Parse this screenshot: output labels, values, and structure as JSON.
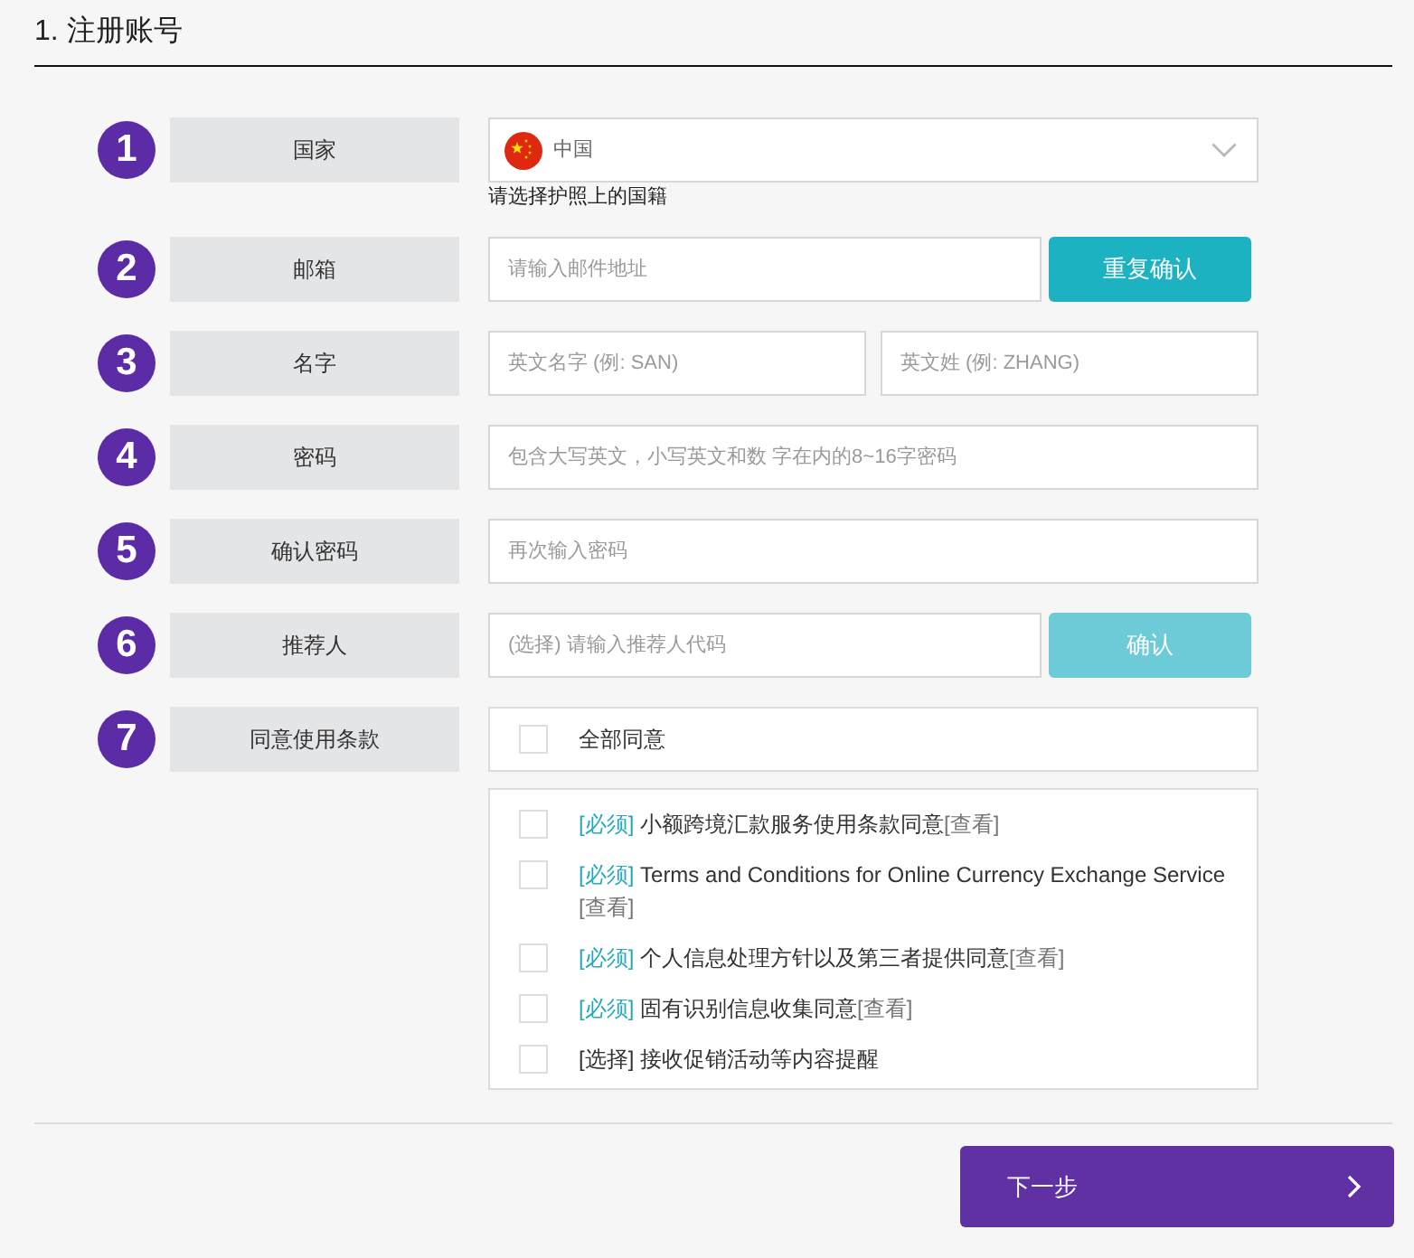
{
  "section_title": "1. 注册账号",
  "rows": [
    {
      "number": "1",
      "label": "国家",
      "kind": "select",
      "value": "中国",
      "hint": "请选择护照上的国籍"
    },
    {
      "number": "2",
      "label": "邮箱",
      "kind": "input_button",
      "placeholder": "请输入邮件地址",
      "button": {
        "label": "重复确认",
        "disabled": false
      }
    },
    {
      "number": "3",
      "label": "名字",
      "kind": "input_pair",
      "fields": [
        {
          "placeholder": "英文名字 (例: SAN)"
        },
        {
          "placeholder": "英文姓 (例: ZHANG)"
        }
      ]
    },
    {
      "number": "4",
      "label": "密码",
      "kind": "input",
      "placeholder": "包含大写英文，小写英文和数 字在内的8~16字密码"
    },
    {
      "number": "5",
      "label": "确认密码",
      "kind": "input",
      "placeholder": "再次输入密码"
    },
    {
      "number": "6",
      "label": "推荐人",
      "kind": "input_button",
      "placeholder": "(选择) 请输入推荐人代码",
      "button": {
        "label": "确认",
        "disabled": true
      }
    },
    {
      "number": "7",
      "label": "同意使用条款",
      "kind": "terms",
      "all": {
        "label": "全部同意",
        "checked": false
      },
      "items": [
        {
          "tag": "[必须]",
          "required": true,
          "text": "小额跨境汇款服务使用条款同意",
          "link": "[查看]",
          "checked": false
        },
        {
          "tag": "[必须]",
          "required": true,
          "text": "Terms and Conditions for Online Currency Exchange Service",
          "link": "[查看]",
          "checked": false
        },
        {
          "tag": "[必须]",
          "required": true,
          "text": "个人信息处理方针以及第三者提供同意",
          "link": "[查看]",
          "checked": false
        },
        {
          "tag": "[必须]",
          "required": true,
          "text": "固有识别信息收集同意",
          "link": "[查看]",
          "checked": false
        },
        {
          "tag": "[选择]",
          "required": false,
          "text": "接收促销活动等内容提醒",
          "checked": false
        }
      ]
    }
  ],
  "next_button": {
    "label": "下一步"
  }
}
